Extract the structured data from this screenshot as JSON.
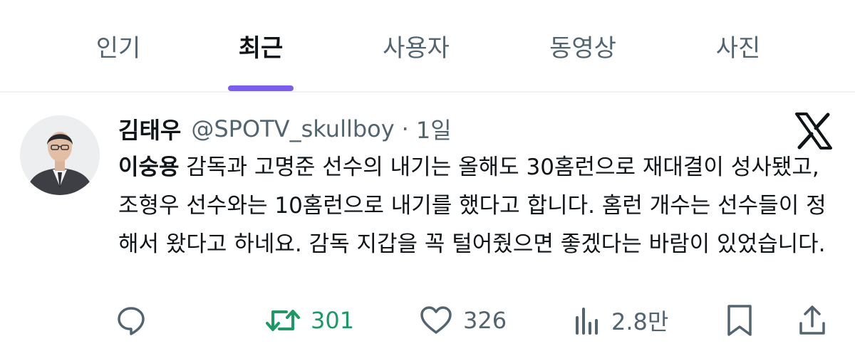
{
  "tabs": [
    {
      "label": "인기",
      "active": false
    },
    {
      "label": "최근",
      "active": true
    },
    {
      "label": "사용자",
      "active": false
    },
    {
      "label": "동영상",
      "active": false
    },
    {
      "label": "사진",
      "active": false
    }
  ],
  "post": {
    "author_name": "김태우",
    "handle": "@SPOTV_skullboy",
    "separator": "·",
    "time": "1일",
    "mention": "이숭용",
    "text": " 감독과 고명준 선수의 내기는 올해도 30홈런으로 재대결이 성사됐고, 조형우 선수와는 10홈런으로 내기를 했다고 합니다. 홈런 개수는 선수들이 정해서 왔다고 하네요. 감독 지갑을 꼭 털어줬으면 좋겠다는 바람이 있었습니다.",
    "avatar_icon": "profile-photo",
    "source_icon": "x-logo-icon"
  },
  "actions": {
    "reply": {
      "icon": "reply-icon"
    },
    "retweet": {
      "icon": "retweet-icon",
      "count": "301",
      "color": "#1a9a64"
    },
    "like": {
      "icon": "heart-icon",
      "count": "326"
    },
    "views": {
      "icon": "views-icon",
      "count": "2.8만"
    },
    "bookmark": {
      "icon": "bookmark-icon"
    },
    "share": {
      "icon": "share-icon"
    }
  },
  "colors": {
    "accent": "#7c5cf2",
    "text": "#0f1419",
    "muted": "#536471",
    "retweet": "#1a9a64"
  }
}
